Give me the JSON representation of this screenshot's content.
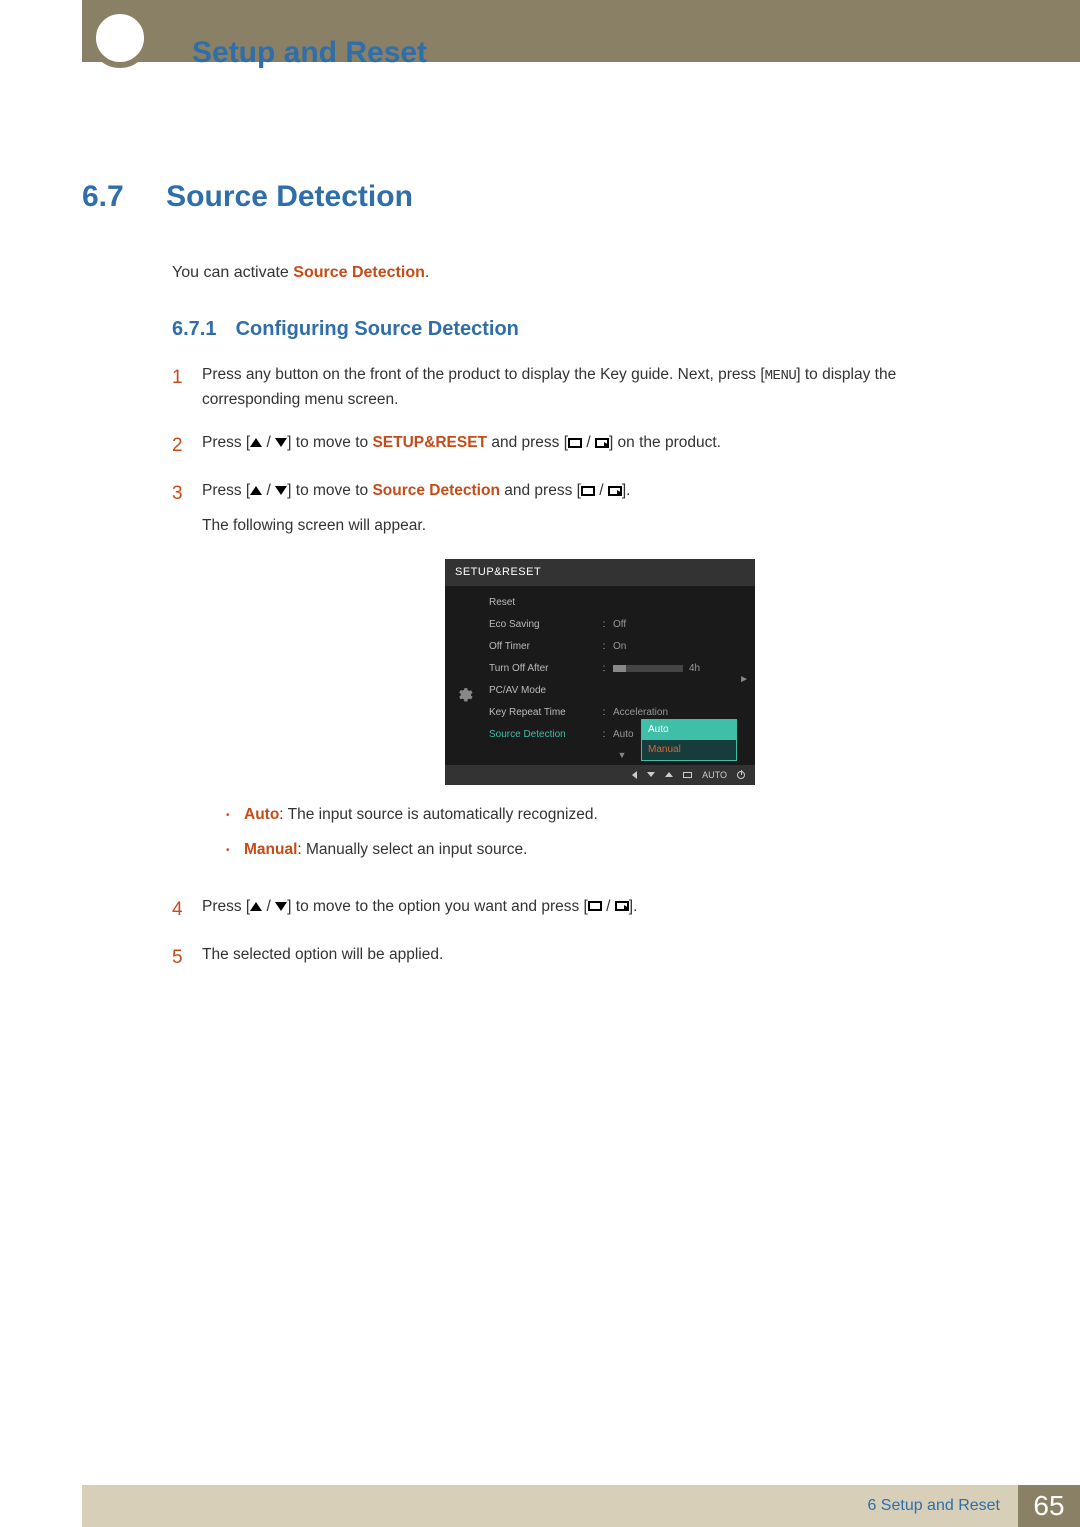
{
  "header": {
    "chapter_title": "Setup and Reset"
  },
  "section": {
    "num": "6.7",
    "title": "Source Detection",
    "intro_pre": "You can activate ",
    "intro_hl": "Source Detection",
    "intro_post": "."
  },
  "subsection": {
    "num": "6.7.1",
    "title": "Configuring Source Detection"
  },
  "steps": {
    "s1_num": "1",
    "s1_a": "Press any button on the front of the product to display the Key guide. Next, press [",
    "s1_menu": "MENU",
    "s1_b": "] to display the corresponding menu screen.",
    "s2_num": "2",
    "s2_a": "Press [",
    "s2_b": "] to move to ",
    "s2_hl": "SETUP&RESET",
    "s2_c": " and press [",
    "s2_d": "] on the product.",
    "s3_num": "3",
    "s3_a": "Press [",
    "s3_b": "] to move to ",
    "s3_hl": "Source Detection",
    "s3_c": " and press [",
    "s3_d": "].",
    "s3_after": "The following screen will appear.",
    "s4_num": "4",
    "s4_a": "Press [",
    "s4_b": "] to move to the option you want and press [",
    "s4_c": "].",
    "s5_num": "5",
    "s5_text": "The selected option will be applied."
  },
  "bullets": {
    "b1_hl": "Auto",
    "b1_txt": ": The input source is automatically recognized.",
    "b2_hl": "Manual",
    "b2_txt": ": Manually select an input source."
  },
  "osd": {
    "title": "SETUP&RESET",
    "rows": {
      "reset": "Reset",
      "eco": "Eco Saving",
      "eco_v": "Off",
      "off_timer": "Off Timer",
      "off_timer_v": "On",
      "turn_off": "Turn Off After",
      "turn_off_v": "4h",
      "pcav": "PC/AV Mode",
      "key_rpt": "Key Repeat Time",
      "key_rpt_v": "Acceleration",
      "src_det": "Source Detection",
      "src_det_v": "Auto"
    },
    "popup": {
      "auto": "Auto",
      "manual": "Manual"
    },
    "footer_auto": "AUTO"
  },
  "footer": {
    "chapter": "6 Setup and Reset",
    "page": "65"
  }
}
